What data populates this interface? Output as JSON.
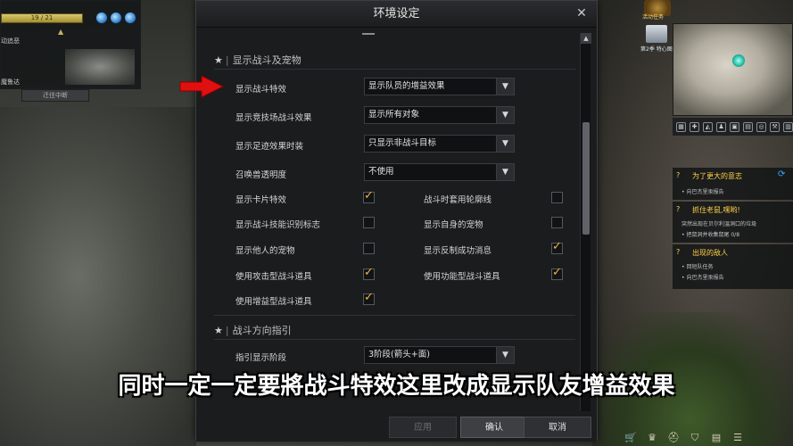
{
  "party_frame": {
    "hp_text": "19 / 21",
    "label_top": "动追恶",
    "label_bottom": "魔鲁达",
    "button_label": "迁往中断"
  },
  "hud": {
    "icon_a_label": "活动任务",
    "icon_b_label": "第2季 特心图鉴"
  },
  "quests": [
    {
      "title": "为了更大的意志",
      "sub": "• 向巴杰里汞报告"
    },
    {
      "title": "抓住老鼠,嘿哟!",
      "sub": "突然出现在贝尔利温洞口的垃圾",
      "sub2": "• 把鼠洞并收集鼠尾   0/8"
    },
    {
      "title": "出现的敌人",
      "sub": "• 回短队任务",
      "sub2": "• 向巴杰里汞报告"
    }
  ],
  "dialog": {
    "title": "环境设定",
    "close_icon": "close-icon",
    "section1": "显示战斗及宠物",
    "section2": "战斗方向指引",
    "dropdown_rows": [
      {
        "label": "显示战斗特效",
        "value": "显示队员的增益效果"
      },
      {
        "label": "显示竞技场战斗效果",
        "value": "显示所有对象"
      },
      {
        "label": "显示足迹效果时装",
        "value": "只显示非战斗目标"
      },
      {
        "label": "召唤兽透明度",
        "value": "不使用"
      }
    ],
    "checkbox_rows": [
      {
        "left": {
          "label": "显示卡片特效",
          "checked": true
        },
        "right": {
          "label": "战斗时套用轮廓线",
          "checked": false
        }
      },
      {
        "left": {
          "label": "显示战斗技能识别标志",
          "checked": false
        },
        "right": {
          "label": "显示自身的宠物",
          "checked": false
        }
      },
      {
        "left": {
          "label": "显示他人的宠物",
          "checked": false
        },
        "right": {
          "label": "显示反制成功消息",
          "checked": true
        }
      },
      {
        "left": {
          "label": "使用攻击型战斗道具",
          "checked": true
        },
        "right": {
          "label": "使用功能型战斗道具",
          "checked": true
        }
      },
      {
        "left": {
          "label": "使用增益型战斗道具",
          "checked": true
        }
      }
    ],
    "guide_row": {
      "label": "指引显示阶段",
      "value": "3阶段(箭头+面)"
    },
    "footer": {
      "apply": "应用",
      "ok": "确认",
      "cancel": "取消"
    }
  },
  "subtitle": "同时一定一定要將战斗特效这里改成显示队友增益效果",
  "colors": {
    "accent_check": "#e8b84a",
    "arrow_red": "#e01010",
    "quest_yellow": "#ffd24a"
  }
}
